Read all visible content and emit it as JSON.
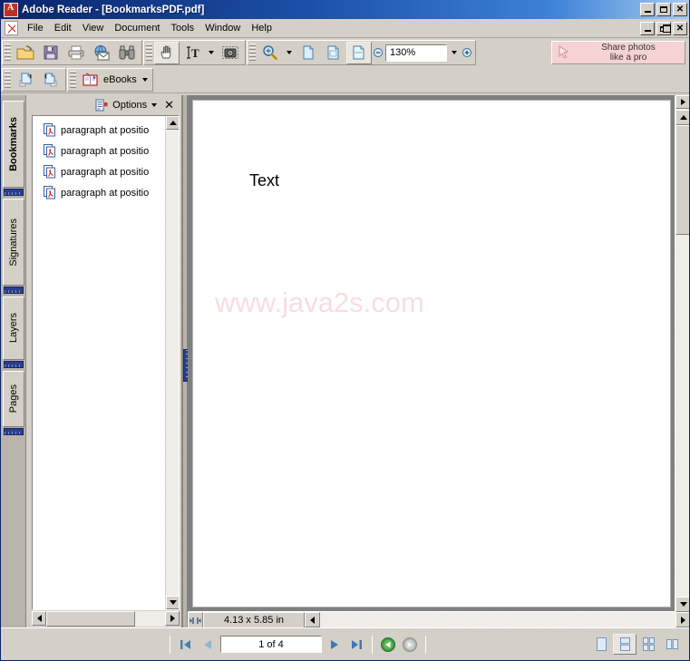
{
  "window": {
    "title": "Adobe Reader - [BookmarksPDF.pdf]",
    "app_icon": "adobe-reader-icon",
    "minimize_label": "Minimize",
    "maximize_label": "Maximize",
    "close_label": "Close",
    "doc_minimize_label": "Minimize Document",
    "doc_restore_label": "Restore Document",
    "doc_close_label": "Close Document"
  },
  "menu": {
    "items": [
      {
        "label": "File"
      },
      {
        "label": "Edit"
      },
      {
        "label": "View"
      },
      {
        "label": "Document"
      },
      {
        "label": "Tools"
      },
      {
        "label": "Window"
      },
      {
        "label": "Help"
      }
    ]
  },
  "toolbar": {
    "file_group": [
      {
        "name": "open-button",
        "icon": "open-folder-icon",
        "title": "Open"
      },
      {
        "name": "save-button",
        "icon": "floppy-disk-icon",
        "title": "Save a Copy"
      },
      {
        "name": "print-button",
        "icon": "printer-icon",
        "title": "Print"
      },
      {
        "name": "email-button",
        "icon": "globe-envelope-icon",
        "title": "Email"
      },
      {
        "name": "search-button",
        "icon": "binoculars-icon",
        "title": "Search"
      }
    ],
    "tools_group": [
      {
        "name": "hand-tool-button",
        "icon": "hand-icon",
        "title": "Hand Tool",
        "pressed": true
      },
      {
        "name": "select-text-button",
        "icon": "text-select-icon",
        "title": "Select Text"
      },
      {
        "name": "snapshot-button",
        "icon": "camera-icon",
        "title": "Snapshot Tool"
      }
    ],
    "zoom_group": [
      {
        "name": "zoom-in-tool-button",
        "icon": "magnifier-icon",
        "title": "Zoom In Tool"
      },
      {
        "name": "actual-size-button",
        "icon": "page-actual-icon",
        "title": "Actual Size"
      },
      {
        "name": "fit-page-button",
        "icon": "page-fit-icon",
        "title": "Fit Page"
      },
      {
        "name": "fit-width-button",
        "icon": "page-width-icon",
        "title": "Fit Width",
        "pressed": true
      }
    ],
    "zoom_out_title": "Zoom Out",
    "zoom_in_title": "Zoom In",
    "zoom_value": "130%",
    "ad": {
      "line1": "Share photos",
      "line2": "like a pro",
      "icon": "cursor-arrow-icon"
    }
  },
  "toolbar2": {
    "buttons": [
      {
        "name": "previous-view-button",
        "icon": "page-forward-icon",
        "title": "Previous View"
      },
      {
        "name": "next-view-button",
        "icon": "page-back-icon",
        "title": "Next View"
      }
    ],
    "ebooks_label": "eBooks",
    "ebooks_icon": "ebook-icon"
  },
  "sidebar": {
    "tabs": [
      {
        "label": "Bookmarks",
        "active": true
      },
      {
        "label": "Signatures",
        "active": false
      },
      {
        "label": "Layers",
        "active": false
      },
      {
        "label": "Pages",
        "active": false
      }
    ],
    "options_label": "Options",
    "options_icon": "bookmark-list-icon",
    "close_icon": "close-icon",
    "bookmarks": [
      {
        "label": "paragraph at positio",
        "icon": "pdf-bookmark-icon"
      },
      {
        "label": "paragraph at positio",
        "icon": "pdf-bookmark-icon"
      },
      {
        "label": "paragraph at positio",
        "icon": "pdf-bookmark-icon"
      },
      {
        "label": "paragraph at positio",
        "icon": "pdf-bookmark-icon"
      }
    ]
  },
  "document": {
    "page_text": "Text",
    "watermark": "www.java2s.com",
    "page_size": "4.13 x 5.85 in",
    "split_icon": "split-view-icon"
  },
  "statusbar": {
    "first_page_title": "First Page",
    "previous_page_title": "Previous Page",
    "page_indicator": "1 of 4",
    "next_page_title": "Next Page",
    "last_page_title": "Last Page",
    "previous_view_title": "Previous View",
    "next_view_title": "Next View",
    "view_modes": [
      {
        "name": "single-page-view-button",
        "icon": "single-page-icon",
        "pressed": false
      },
      {
        "name": "continuous-view-button",
        "icon": "continuous-page-icon",
        "pressed": true
      },
      {
        "name": "facing-view-button",
        "icon": "facing-pages-icon",
        "pressed": false
      },
      {
        "name": "continuous-facing-view-button",
        "icon": "continuous-facing-icon",
        "pressed": false
      }
    ]
  },
  "colors": {
    "title_bar_start": "#0a246a",
    "title_bar_end": "#a6caf0",
    "chrome": "#d4d0c8",
    "doc_background": "#808080",
    "watermark": "#f9dede",
    "ad_background": "#f6d2d2",
    "splitter_grip": "#2a3e8c"
  }
}
